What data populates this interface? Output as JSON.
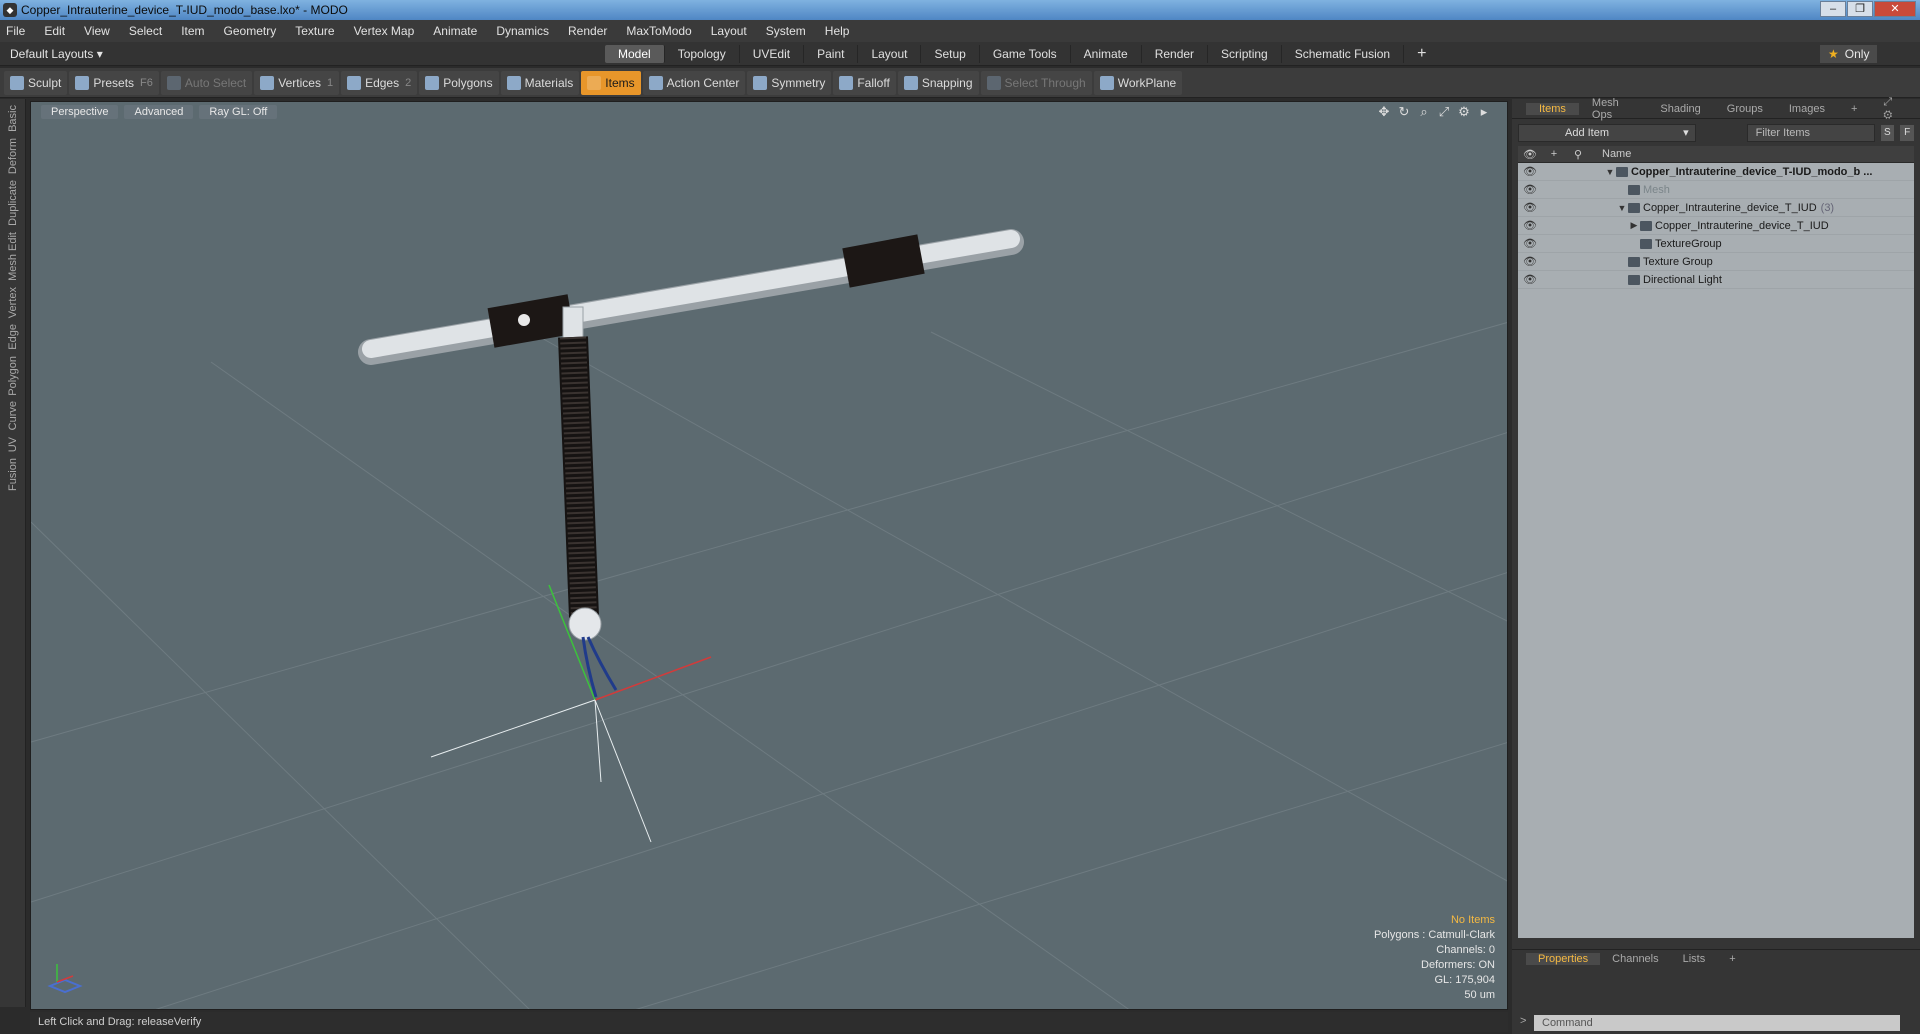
{
  "window": {
    "title": "Copper_Intrauterine_device_T-IUD_modo_base.lxo* - MODO",
    "buttons": [
      "‒",
      "❐",
      "✕"
    ]
  },
  "menu": [
    "File",
    "Edit",
    "View",
    "Select",
    "Item",
    "Geometry",
    "Texture",
    "Vertex Map",
    "Animate",
    "Dynamics",
    "Render",
    "MaxToModo",
    "Layout",
    "System",
    "Help"
  ],
  "layout": {
    "label": "Default Layouts ▾",
    "tabs": [
      "Model",
      "Topology",
      "UVEdit",
      "Paint",
      "Layout",
      "Setup",
      "Game Tools",
      "Animate",
      "Render",
      "Scripting",
      "Schematic Fusion"
    ],
    "active_tab": "Model",
    "plus": "+",
    "only_label": "Only"
  },
  "toolbar": {
    "sculpt": "Sculpt",
    "presets": "Presets",
    "presets_key": "F6",
    "auto_select": "Auto Select",
    "vertices": "Vertices",
    "vertices_key": "1",
    "edges": "Edges",
    "edges_key": "2",
    "polygons": "Polygons",
    "materials": "Materials",
    "items": "Items",
    "action_center": "Action Center",
    "symmetry": "Symmetry",
    "falloff": "Falloff",
    "snapping": "Snapping",
    "select_through": "Select Through",
    "workplane": "WorkPlane"
  },
  "leftrail": [
    "Basic",
    "Deform",
    "Duplicate",
    "Mesh Edit",
    "Vertex",
    "Edge",
    "Polygon",
    "Curve",
    "UV",
    "Fusion"
  ],
  "viewport": {
    "view": "Perspective",
    "shading": "Advanced",
    "raygl": "Ray GL: Off",
    "info": {
      "no_items": "No Items",
      "polygons": "Polygons : Catmull-Clark",
      "channels": "Channels: 0",
      "deformers": "Deformers: ON",
      "gl": "GL: 175,904",
      "scale": "50 um"
    }
  },
  "status": {
    "text": "Left Click and Drag:   releaseVerify"
  },
  "panel": {
    "tabs": [
      "Items",
      "Mesh Ops",
      "Shading",
      "Groups",
      "Images",
      "+"
    ],
    "active_tab": "Items",
    "add_item": "Add Item",
    "filter": "Filter Items",
    "s": "S",
    "f": "F",
    "col_name": "Name",
    "tree": [
      {
        "label": "Copper_Intrauterine_device_T-IUD_modo_b ...",
        "bold": true,
        "dim": false,
        "indent": 0,
        "twisty": "▼",
        "count": ""
      },
      {
        "label": "Mesh",
        "bold": false,
        "dim": true,
        "indent": 1,
        "twisty": "",
        "count": ""
      },
      {
        "label": "Copper_Intrauterine_device_T_IUD",
        "bold": false,
        "dim": false,
        "indent": 1,
        "twisty": "▼",
        "count": "(3)"
      },
      {
        "label": "Copper_Intrauterine_device_T_IUD",
        "bold": false,
        "dim": false,
        "indent": 2,
        "twisty": "▶",
        "count": ""
      },
      {
        "label": "TextureGroup",
        "bold": false,
        "dim": false,
        "indent": 2,
        "twisty": "",
        "count": ""
      },
      {
        "label": "Texture Group",
        "bold": false,
        "dim": false,
        "indent": 1,
        "twisty": "",
        "count": ""
      },
      {
        "label": "Directional Light",
        "bold": false,
        "dim": false,
        "indent": 1,
        "twisty": "",
        "count": ""
      }
    ],
    "bottom_tabs": [
      "Properties",
      "Channels",
      "Lists",
      "+"
    ],
    "command_placeholder": "Command"
  },
  "colors": {
    "accent": "#e8962a",
    "viewport_bg": "#5c6a70",
    "tree_bg": "#a8aeb2"
  }
}
